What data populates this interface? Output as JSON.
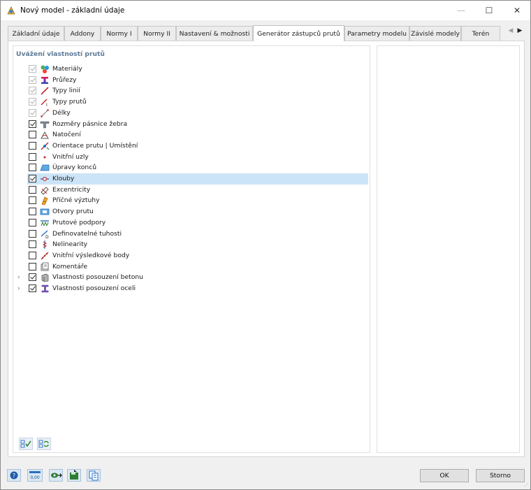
{
  "window": {
    "title": "Nový model - základní údaje",
    "controls": {
      "minimize": "—",
      "maximize": "☐",
      "close": "✕"
    }
  },
  "tabs": [
    {
      "label": "Základní údaje",
      "active": false
    },
    {
      "label": "Addony",
      "active": false
    },
    {
      "label": "Normy I",
      "active": false
    },
    {
      "label": "Normy II",
      "active": false
    },
    {
      "label": "Nastavení & možnosti",
      "active": false
    },
    {
      "label": "Generátor zástupců prutů",
      "active": true
    },
    {
      "label": "Parametry modelu",
      "active": false
    },
    {
      "label": "Závislé modely",
      "active": false
    },
    {
      "label": "Terén",
      "active": false
    }
  ],
  "tab_scroll": {
    "left": "◀",
    "right": "▶"
  },
  "section_title": "Uvážení vlastností prutů",
  "items": [
    {
      "label": "Materiály",
      "checked": true,
      "enabled": false,
      "icon": "materials-icon",
      "expandable": false
    },
    {
      "label": "Průřezy",
      "checked": true,
      "enabled": false,
      "icon": "cross-sections-icon",
      "expandable": false
    },
    {
      "label": "Typy linií",
      "checked": true,
      "enabled": false,
      "icon": "line-types-icon",
      "expandable": false
    },
    {
      "label": "Typy prutů",
      "checked": true,
      "enabled": false,
      "icon": "member-types-icon",
      "expandable": false
    },
    {
      "label": "Délky",
      "checked": true,
      "enabled": false,
      "icon": "lengths-icon",
      "expandable": false
    },
    {
      "label": "Rozměry pásnice žebra",
      "checked": true,
      "enabled": true,
      "icon": "rib-flange-icon",
      "expandable": false
    },
    {
      "label": "Natočení",
      "checked": false,
      "enabled": true,
      "icon": "rotation-icon",
      "expandable": false
    },
    {
      "label": "Orientace prutu | Umístění",
      "checked": false,
      "enabled": true,
      "icon": "member-orientation-icon",
      "expandable": false
    },
    {
      "label": "Vnitřní uzly",
      "checked": false,
      "enabled": true,
      "icon": "internal-nodes-icon",
      "expandable": false
    },
    {
      "label": "Úpravy konců",
      "checked": false,
      "enabled": true,
      "icon": "end-modifications-icon",
      "expandable": false
    },
    {
      "label": "Klouby",
      "checked": true,
      "enabled": true,
      "icon": "hinges-icon",
      "expandable": false,
      "selected": true
    },
    {
      "label": "Excentricity",
      "checked": false,
      "enabled": true,
      "icon": "eccentricities-icon",
      "expandable": false
    },
    {
      "label": "Příčné výztuhy",
      "checked": false,
      "enabled": true,
      "icon": "transverse-stiffeners-icon",
      "expandable": false
    },
    {
      "label": "Otvory prutu",
      "checked": false,
      "enabled": true,
      "icon": "member-openings-icon",
      "expandable": false
    },
    {
      "label": "Prutové podpory",
      "checked": false,
      "enabled": true,
      "icon": "member-supports-icon",
      "expandable": false
    },
    {
      "label": "Definovatelné tuhosti",
      "checked": false,
      "enabled": true,
      "icon": "definable-stiffness-icon",
      "expandable": false
    },
    {
      "label": "Nelinearity",
      "checked": false,
      "enabled": true,
      "icon": "nonlinearities-icon",
      "expandable": false
    },
    {
      "label": "Vnitřní výsledkové body",
      "checked": false,
      "enabled": true,
      "icon": "result-points-icon",
      "expandable": false
    },
    {
      "label": "Komentáře",
      "checked": false,
      "enabled": true,
      "icon": "comments-icon",
      "expandable": false
    },
    {
      "label": "Vlastnosti posouzení betonu",
      "checked": true,
      "enabled": true,
      "icon": "concrete-design-icon",
      "expandable": true
    },
    {
      "label": "Vlastnosti posouzení oceli",
      "checked": true,
      "enabled": true,
      "icon": "steel-design-icon",
      "expandable": true
    }
  ],
  "footer": {
    "ok_label": "OK",
    "cancel_label": "Storno",
    "units_icon_text": "0,00"
  },
  "colors": {
    "selection": "#cce4f7",
    "section_title": "#5f7a97",
    "accent_blue": "#2a6fc1"
  }
}
